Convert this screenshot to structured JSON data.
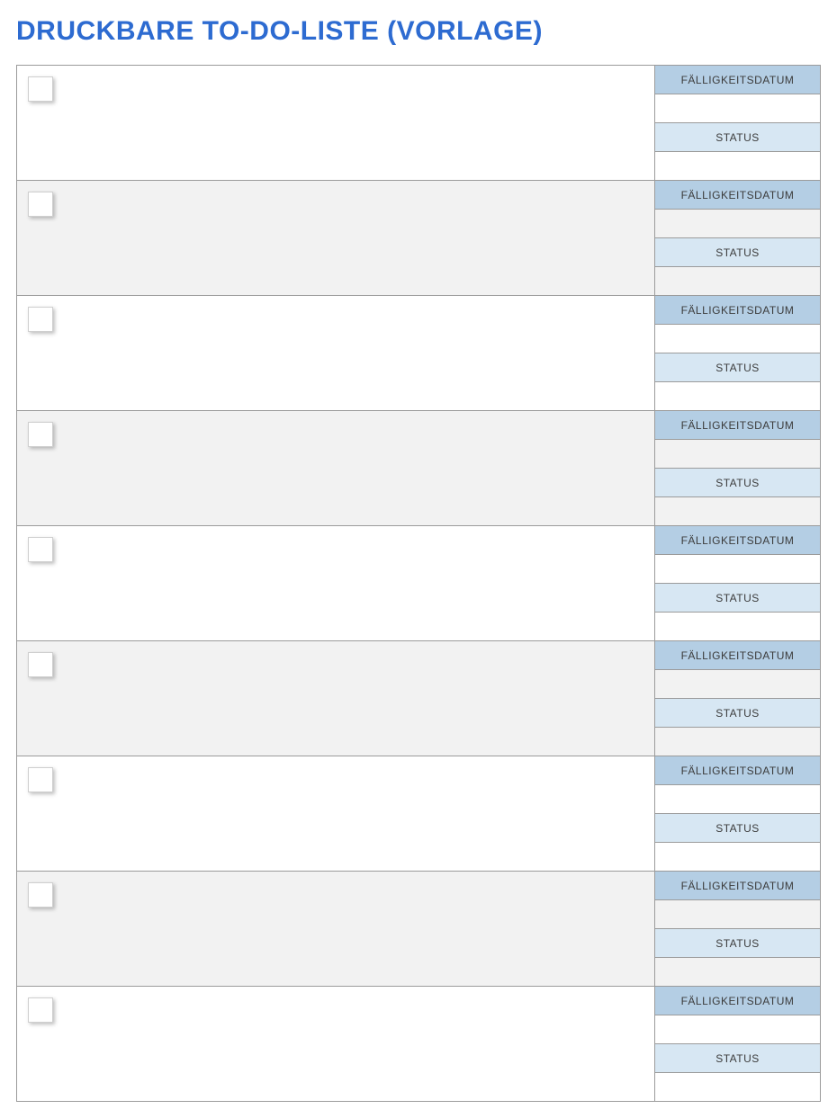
{
  "title": "DRUCKBARE TO-DO-LISTE (VORLAGE)",
  "labels": {
    "due": "FÄLLIGKEITSDATUM",
    "status": "STATUS"
  },
  "rows": [
    {
      "task": "",
      "due": "",
      "status": ""
    },
    {
      "task": "",
      "due": "",
      "status": ""
    },
    {
      "task": "",
      "due": "",
      "status": ""
    },
    {
      "task": "",
      "due": "",
      "status": ""
    },
    {
      "task": "",
      "due": "",
      "status": ""
    },
    {
      "task": "",
      "due": "",
      "status": ""
    },
    {
      "task": "",
      "due": "",
      "status": ""
    },
    {
      "task": "",
      "due": "",
      "status": ""
    },
    {
      "task": "",
      "due": "",
      "status": ""
    }
  ]
}
